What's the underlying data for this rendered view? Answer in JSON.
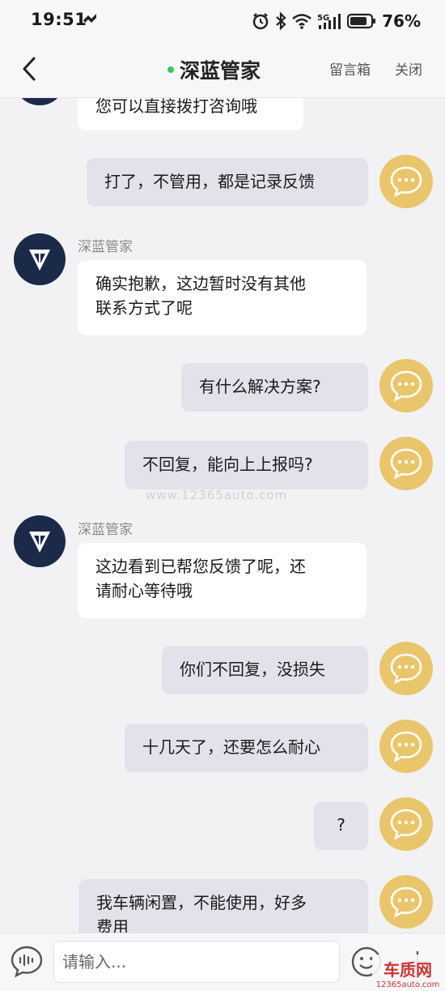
{
  "status_bar": {
    "time": "19:51",
    "battery": "76%",
    "network": "5G"
  },
  "header": {
    "title": "深蓝管家",
    "inbox": "留言箱",
    "close": "关闭"
  },
  "messages": [
    {
      "from": "agent",
      "text": "您可以直接拨打咨询哦"
    },
    {
      "from": "user",
      "text": "打了，不管用，都是记录反馈"
    },
    {
      "from": "agent",
      "sender": "深蓝管家",
      "lines": [
        "确实抱歉，这边暂时没有其他",
        "联系方式了呢"
      ]
    },
    {
      "from": "user",
      "text": "有什么解决方案?"
    },
    {
      "from": "user",
      "text": "不回复，能向上上报吗?"
    },
    {
      "from": "agent",
      "sender": "深蓝管家",
      "lines": [
        "这边看到已帮您反馈了呢，还",
        "请耐心等待哦"
      ]
    },
    {
      "from": "user",
      "text": "你们不回复，没损失"
    },
    {
      "from": "user",
      "text": "十几天了，还要怎么耐心"
    },
    {
      "from": "user",
      "text": "?"
    },
    {
      "from": "user",
      "lines": [
        "我车辆闲置，不能使用，好多",
        "费用"
      ]
    }
  ],
  "watermark": "www.12365auto.com",
  "input": {
    "placeholder": "请输入..."
  },
  "logo": {
    "text": "车质网",
    "url": "12365auto.com"
  },
  "colors": {
    "user_avatar": "#e9c56c",
    "agent_avatar": "#1c2a4a",
    "online": "#35c759"
  }
}
